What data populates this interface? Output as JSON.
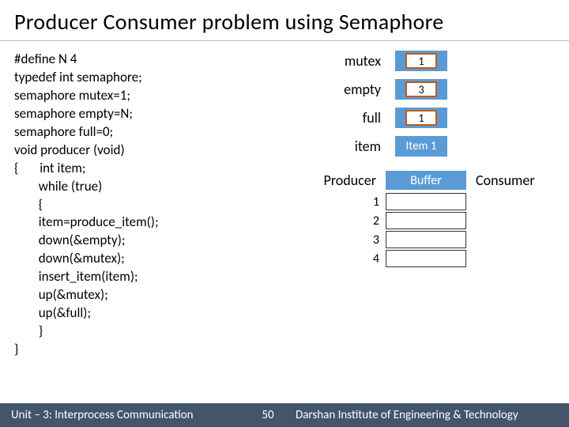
{
  "title": "Producer Consumer problem using Semaphore",
  "code": "#define N 4\ntypedef int semaphore;\nsemaphore mutex=1;\nsemaphore empty=N;\nsemaphore full=0;\nvoid producer (void)\n{       int item;\n        while (true)\n        {\n        item=produce_item();\n        down(&empty);\n        down(&mutex);\n        insert_item(item);\n        up(&mutex);\n        up(&full);\n        }\n}",
  "sem": {
    "mutex": {
      "label": "mutex",
      "value": "1"
    },
    "empty": {
      "label": "empty",
      "value": "3"
    },
    "full": {
      "label": "full",
      "value": "1"
    },
    "item": {
      "label": "item",
      "value": "Item 1"
    }
  },
  "buffer": {
    "producer_label": "Producer",
    "buffer_label": "Buffer",
    "consumer_label": "Consumer",
    "slots": [
      "1",
      "2",
      "3",
      "4"
    ]
  },
  "footer": {
    "unit": "Unit – 3: Interprocess Communication",
    "page": "50",
    "org": "Darshan Institute of Engineering & Technology"
  }
}
